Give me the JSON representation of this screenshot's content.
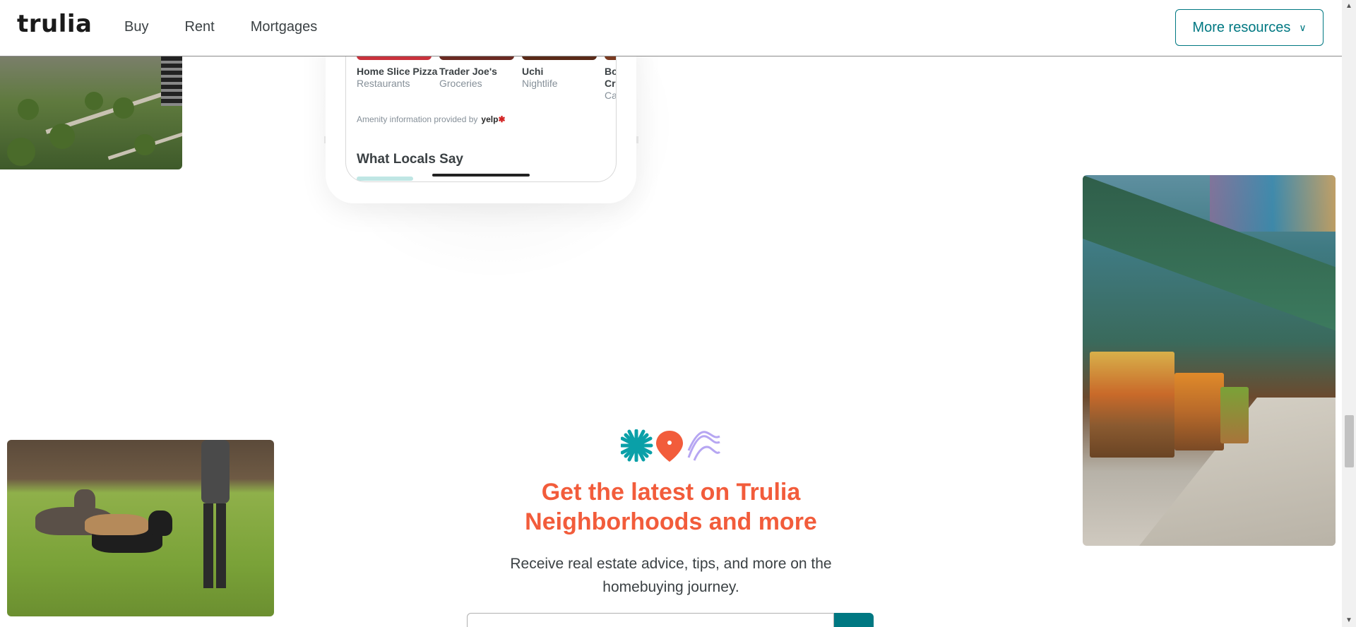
{
  "header": {
    "logo": "trulia",
    "nav": [
      "Buy",
      "Rent",
      "Mortgages"
    ],
    "more_resources": "More resources",
    "chevron": "∨"
  },
  "phone": {
    "amenities": [
      {
        "name": "Home Slice Pizza",
        "category": "Restaurants",
        "thumb_color": "#c9323c"
      },
      {
        "name": "Trader Joe's",
        "category": "Groceries",
        "thumb_color": "#6b2a22"
      },
      {
        "name": "Uchi",
        "category": "Nightlife",
        "thumb_color": "#5a2a18"
      },
      {
        "name": "Bo Cr",
        "category": "Ca",
        "thumb_color": "#7a3a20"
      }
    ],
    "amenity_credit": "Amenity information provided by",
    "yelp_logo": "yelp",
    "what_locals_say": "What Locals Say"
  },
  "newsletter": {
    "title": "Get the latest on Trulia Neighborhoods and more",
    "subtitle": "Receive real estate advice, tips, and more on the homebuying journey.",
    "email_placeholder": ""
  },
  "colors": {
    "accent_teal": "#007882",
    "accent_orange": "#f25c3b",
    "accent_purple": "#b6a6f2"
  },
  "icons": [
    "asterisk-burst-icon",
    "map-pin-icon",
    "waves-icon",
    "chevron-down-icon",
    "scroll-up-arrow-icon",
    "scroll-down-arrow-icon"
  ]
}
